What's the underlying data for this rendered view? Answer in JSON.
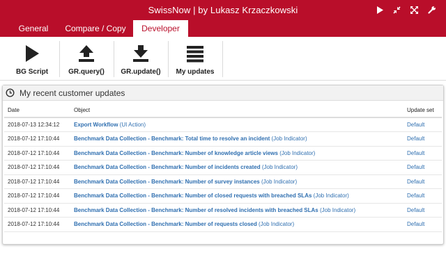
{
  "window": {
    "title": "SwissNow | by Lukasz Krzaczkowski",
    "controls": [
      {
        "name": "play-icon",
        "label": "run"
      },
      {
        "name": "shrink-icon",
        "label": "minimize"
      },
      {
        "name": "expand-icon",
        "label": "maximize"
      },
      {
        "name": "wrench-icon",
        "label": "settings"
      }
    ]
  },
  "tabs": [
    {
      "label": "General",
      "active": false
    },
    {
      "label": "Compare / Copy",
      "active": false
    },
    {
      "label": "Developer",
      "active": true
    }
  ],
  "toolbar": {
    "bg_script": "BG Script",
    "gr_query": "GR.query()",
    "gr_update": "GR.update()",
    "my_updates": "My updates"
  },
  "panel": {
    "title": "My recent customer updates",
    "columns": {
      "date": "Date",
      "object": "Object",
      "update_set": "Update set"
    },
    "rows": [
      {
        "date": "2018-07-13 12:34:12",
        "object": "Export Workflow",
        "type": "(UI Action)",
        "update_set": "Default"
      },
      {
        "date": "2018-07-12 17:10:44",
        "object": "Benchmark Data Collection - Benchmark: Total time to resolve an incident",
        "type": "(Job Indicator)",
        "update_set": "Default"
      },
      {
        "date": "2018-07-12 17:10:44",
        "object": "Benchmark Data Collection - Benchmark: Number of knowledge article views",
        "type": "(Job Indicator)",
        "update_set": "Default"
      },
      {
        "date": "2018-07-12 17:10:44",
        "object": "Benchmark Data Collection - Benchmark: Number of incidents created",
        "type": "(Job Indicator)",
        "update_set": "Default"
      },
      {
        "date": "2018-07-12 17:10:44",
        "object": "Benchmark Data Collection - Benchmark: Number of survey instances",
        "type": "(Job Indicator)",
        "update_set": "Default"
      },
      {
        "date": "2018-07-12 17:10:44",
        "object": "Benchmark Data Collection - Benchmark: Number of closed requests with breached SLAs",
        "type": "(Job Indicator)",
        "update_set": "Default"
      },
      {
        "date": "2018-07-12 17:10:44",
        "object": "Benchmark Data Collection - Benchmark: Number of resolved incidents with breached SLAs",
        "type": "(Job Indicator)",
        "update_set": "Default"
      },
      {
        "date": "2018-07-12 17:10:44",
        "object": "Benchmark Data Collection - Benchmark: Number of requests closed",
        "type": "(Job Indicator)",
        "update_set": "Default"
      }
    ]
  },
  "colors": {
    "brand": "#b90e2a",
    "link": "#2f6fb0"
  }
}
